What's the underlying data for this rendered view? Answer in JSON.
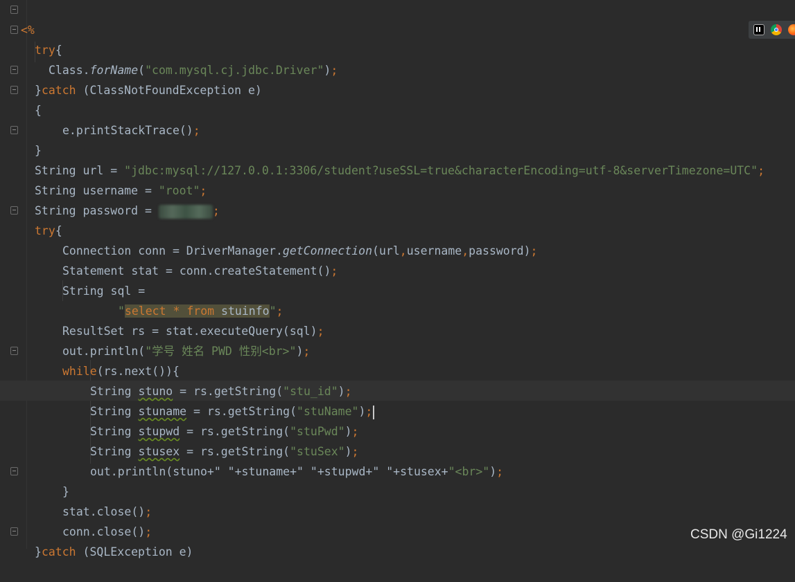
{
  "editor": {
    "lines": {
      "l1": "<%",
      "l2_kw": "try",
      "l2_p": "{",
      "l3_a": "Class.",
      "l3_m": "forName",
      "l3_b": "(",
      "l3_s": "\"com.mysql.cj.jdbc.Driver\"",
      "l3_c": ")",
      "l3_semi": ";",
      "l4_a": "}",
      "l4_kw": "catch",
      "l4_b": " (ClassNotFoundException e)",
      "l5": "{",
      "l6_a": "e.printStackTrace()",
      "l6_semi": ";",
      "l7": "}",
      "l8_a": "String url = ",
      "l8_s": "\"jdbc:mysql://127.0.0.1:3306/student?useSSL=true&characterEncoding=utf-8&serverTimezone=UTC\"",
      "l8_semi": ";",
      "l9_a": "String username = ",
      "l9_s": "\"root\"",
      "l9_semi": ";",
      "l10_a": "String password = ",
      "l10_semi": ";",
      "l11_kw": "try",
      "l11_p": "{",
      "l12_a": "Connection conn = DriverManager.",
      "l12_m": "getConnection",
      "l12_b": "(url",
      "l12_c1": ",",
      "l12_d": "username",
      "l12_c2": ",",
      "l12_e": "password)",
      "l12_semi": ";",
      "l13_a": "Statement stat = conn.createStatement()",
      "l13_semi": ";",
      "l14": "String sql =",
      "l15_q1": "\"",
      "l15_k1": "select",
      "l15_star": " * ",
      "l15_k2": "from",
      "l15_t": " stuinfo",
      "l15_q2": "\"",
      "l15_semi": ";",
      "l16_a": "ResultSet rs = stat.executeQuery(sql)",
      "l16_semi": ";",
      "l17_a": "out.println(",
      "l17_s": "\"学号 姓名 PWD 性别<br>\"",
      "l17_b": ")",
      "l17_semi": ";",
      "l18_kw": "while",
      "l18_b": "(rs.next()){",
      "l19_a": "String ",
      "l19_v": "stuno",
      "l19_b": " = rs.getString(",
      "l19_s": "\"stu_id\"",
      "l19_c": ")",
      "l19_semi": ";",
      "l20_a": "String ",
      "l20_v": "stuname",
      "l20_b": " = rs.getString(",
      "l20_s": "\"stuName\"",
      "l20_c": ")",
      "l20_semi": ";",
      "l21_a": "String ",
      "l21_v": "stupwd",
      "l21_b": " = rs.getString(",
      "l21_s": "\"stuPwd\"",
      "l21_c": ")",
      "l21_semi": ";",
      "l22_a": "String ",
      "l22_v": "stusex",
      "l22_b": " = rs.getString(",
      "l22_s": "\"stuSex\"",
      "l22_c": ")",
      "l22_semi": ";",
      "l23_a": "out.println(stuno+",
      "l23_s1": "\" \"",
      "l23_b": "+stuname+",
      "l23_s2": "\" \"",
      "l23_c": "+stupwd+",
      "l23_s3": "\" \"",
      "l23_d": "+stusex+",
      "l23_s4": "\"<br>\"",
      "l23_e": ")",
      "l23_semi": ";",
      "l24": "}",
      "l25_a": "stat.close()",
      "l25_semi": ";",
      "l26_a": "conn.close()",
      "l26_semi": ";",
      "l27_a": "}",
      "l27_kw": "catch",
      "l27_b": " (SQLException e)"
    }
  },
  "watermark": "CSDN @Gi1224",
  "toolbar_icons": [
    "intellij-icon",
    "chrome-icon",
    "firefox-icon"
  ],
  "colors": {
    "background": "#2b2b2b",
    "keyword": "#cc7832",
    "string": "#6a8759",
    "text": "#a9b7c6"
  }
}
